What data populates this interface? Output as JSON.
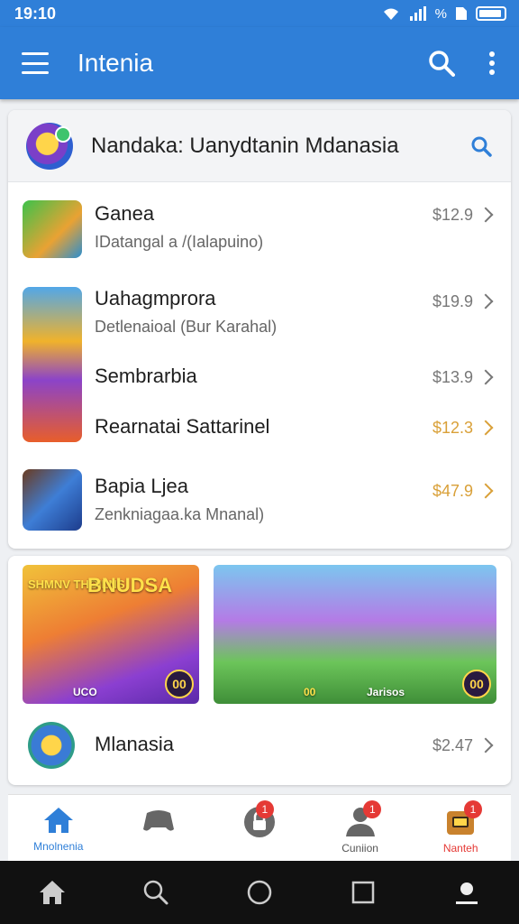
{
  "status_bar": {
    "time": "19:10",
    "signal_text": "%"
  },
  "app_bar": {
    "title": "Intenia"
  },
  "featured": {
    "title": "Nandaka: Uanydtanin  Mdanasia"
  },
  "items": [
    {
      "title": "Ganea",
      "subtitle": "IDatangal a /(Ialapuino)",
      "price": "$12.9"
    },
    {
      "title": "Uahagmprora",
      "subtitle": "Detlenaioal (Bur Karahal)",
      "price": "$19.9"
    },
    {
      "title": "Sembrarbia",
      "subtitle": "",
      "price": "$13.9"
    },
    {
      "title": "Rearnatai Sattarinel",
      "subtitle": "",
      "price": "$12.3"
    },
    {
      "title": "Bapia Ljea",
      "subtitle": "Zenkniagaa.ka Mnanal)",
      "price": "$47.9"
    }
  ],
  "promo": {
    "left_title": "BNUDSA",
    "left_tag": "SHMNV THOILNS",
    "left_badge": "00",
    "left_footer": "UCO",
    "right_footer": "Jarisos",
    "right_badge": "00",
    "right_footer_left": "00"
  },
  "bottom_item": {
    "title": "Mlanasia",
    "price": "$2.47"
  },
  "nav": [
    {
      "label": "Mnolnenia",
      "badge": ""
    },
    {
      "label": "",
      "badge": ""
    },
    {
      "label": "",
      "badge": "1"
    },
    {
      "label": "Cuniion",
      "badge": "1"
    },
    {
      "label": "Nanteh",
      "badge": "1"
    }
  ],
  "colors": {
    "primary": "#2f7fd8",
    "accent_gold": "#d9a038",
    "badge_red": "#e53935"
  }
}
